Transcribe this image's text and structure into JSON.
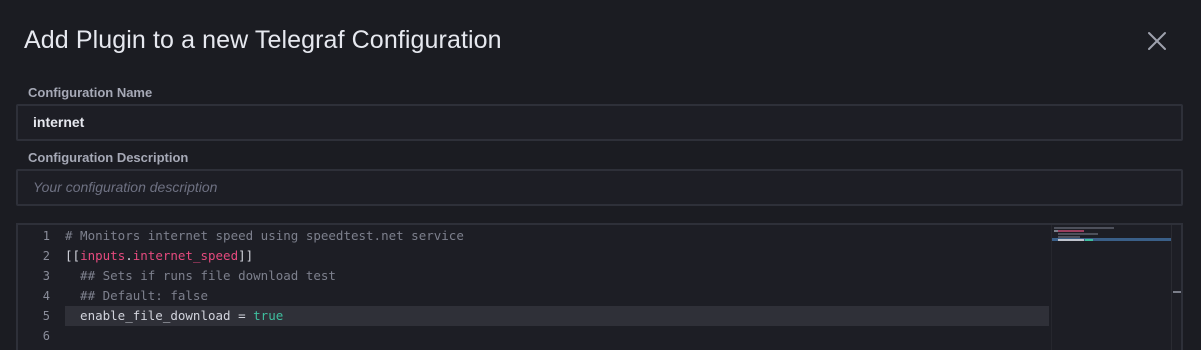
{
  "dialog": {
    "title": "Add Plugin to a new Telegraf Configuration",
    "close_icon": "close-icon"
  },
  "config_name": {
    "label": "Configuration Name",
    "value": "internet"
  },
  "config_description": {
    "label": "Configuration Description",
    "placeholder": "Your configuration description"
  },
  "editor": {
    "line_numbers": [
      "1",
      "2",
      "3",
      "4",
      "5",
      "6"
    ],
    "lines": {
      "l1": {
        "comment": "# Monitors internet speed using speedtest.net service"
      },
      "l2": {
        "open": "[[",
        "ns": "inputs",
        "dot": ".",
        "name": "internet_speed",
        "close": "]]"
      },
      "l3": {
        "comment": "  ## Sets if runs file download test"
      },
      "l4": {
        "comment": "  ## Default: false"
      },
      "l5": {
        "key": "  enable_file_download = ",
        "value": "true"
      },
      "l6": {
        "text": ""
      }
    },
    "active_line": 5
  },
  "colors": {
    "background": "#1b1c22",
    "keyword_pink": "#e64a7e",
    "boolean_green": "#3fbf9f",
    "comment_gray": "#7d808d"
  }
}
